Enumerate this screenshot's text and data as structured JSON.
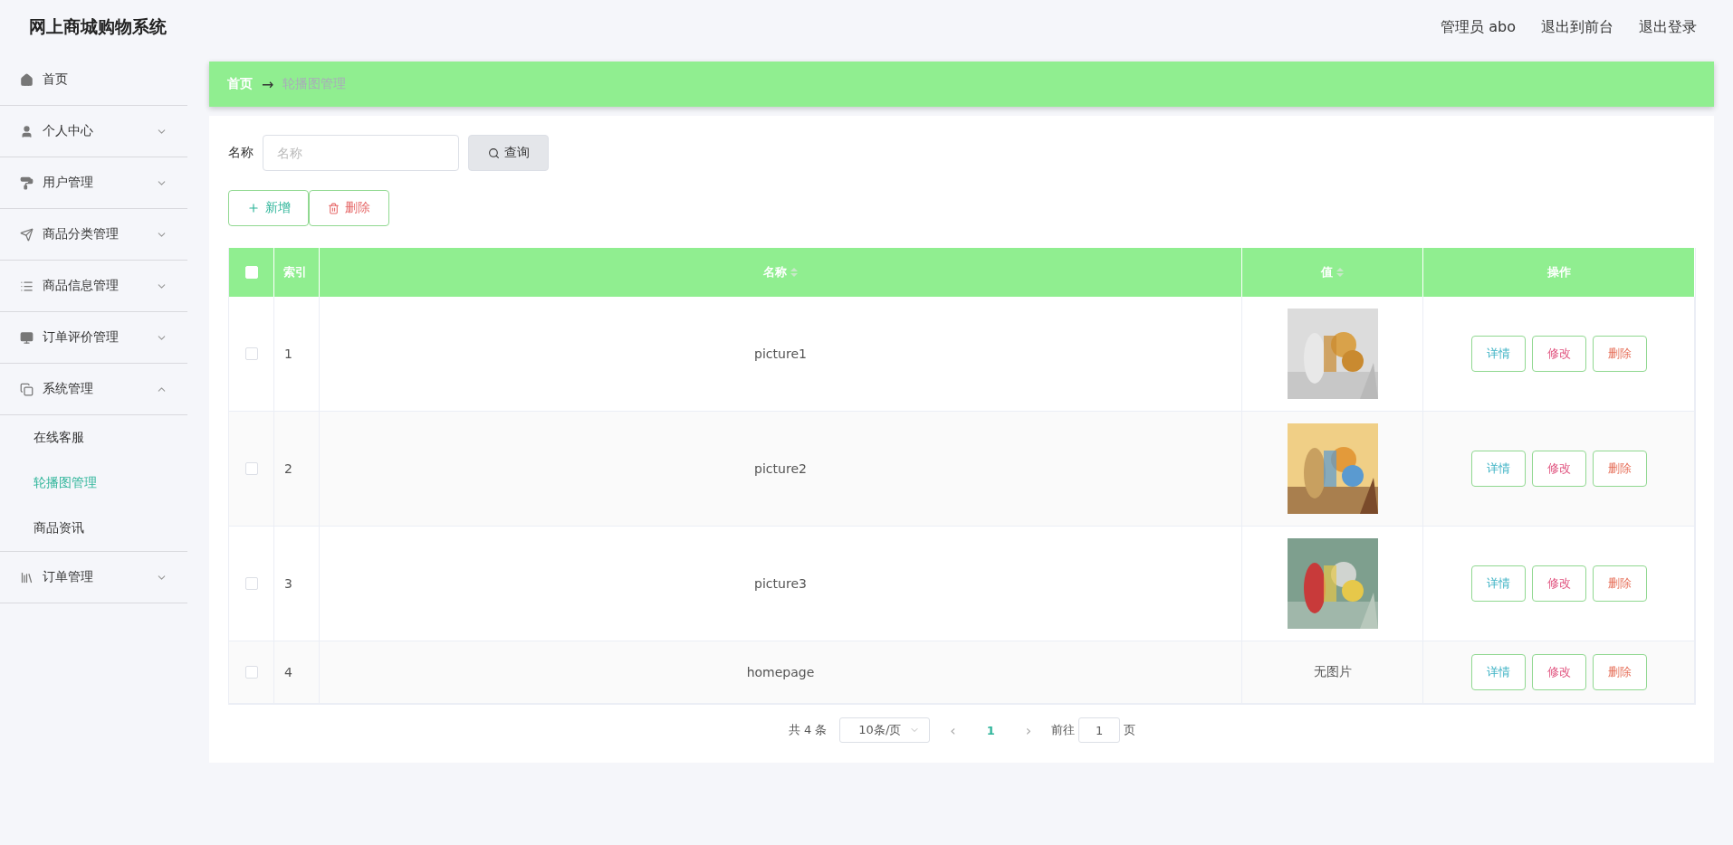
{
  "header": {
    "title": "网上商城购物系统",
    "user": "管理员 abo",
    "links": [
      "退出到前台",
      "退出登录"
    ]
  },
  "sidebar": {
    "items": [
      {
        "label": "首页"
      },
      {
        "label": "个人中心",
        "expandable": true,
        "expanded": false
      },
      {
        "label": "用户管理",
        "expandable": true,
        "expanded": false
      },
      {
        "label": "商品分类管理",
        "expandable": true,
        "expanded": false
      },
      {
        "label": "商品信息管理",
        "expandable": true,
        "expanded": false
      },
      {
        "label": "订单评价管理",
        "expandable": true,
        "expanded": false
      },
      {
        "label": "系统管理",
        "expandable": true,
        "expanded": true,
        "children": [
          {
            "label": "在线客服",
            "selected": false
          },
          {
            "label": "轮播图管理",
            "selected": true
          },
          {
            "label": "商品资讯",
            "selected": false
          }
        ]
      },
      {
        "label": "订单管理",
        "expandable": true,
        "expanded": false
      }
    ]
  },
  "breadcrumb": {
    "home": "首页",
    "separator": "→",
    "current": "轮播图管理"
  },
  "search": {
    "label": "名称",
    "placeholder": "名称",
    "button": "查询"
  },
  "actions": [
    {
      "kind": "add",
      "label": "新增"
    },
    {
      "kind": "delete",
      "label": "删除"
    }
  ],
  "table": {
    "select_all": {
      "checked": false
    },
    "columns": [
      {
        "label": "索引",
        "sortable": false
      },
      {
        "label": "名称",
        "sortable": true
      },
      {
        "label": "值",
        "sortable": true
      },
      {
        "label": "操作",
        "sortable": false
      }
    ],
    "rows": [
      {
        "selected": false,
        "index": "1",
        "name": "picture1",
        "kind": "picture",
        "actions": [
          {
            "kind": "detail",
            "label": "详情"
          },
          {
            "kind": "edit",
            "label": "修改"
          },
          {
            "kind": "delete",
            "label": "删除"
          }
        ]
      },
      {
        "selected": false,
        "index": "2",
        "name": "picture2",
        "kind": "picture",
        "actions": [
          {
            "kind": "detail",
            "label": "详情"
          },
          {
            "kind": "edit",
            "label": "修改"
          },
          {
            "kind": "delete",
            "label": "删除"
          }
        ]
      },
      {
        "selected": false,
        "index": "3",
        "name": "picture3",
        "kind": "picture",
        "actions": [
          {
            "kind": "detail",
            "label": "详情"
          },
          {
            "kind": "edit",
            "label": "修改"
          },
          {
            "kind": "delete",
            "label": "删除"
          }
        ]
      },
      {
        "selected": false,
        "index": "4",
        "name": "homepage",
        "kind": "text",
        "value": "无图片",
        "actions": [
          {
            "kind": "detail",
            "label": "详情"
          },
          {
            "kind": "edit",
            "label": "修改"
          },
          {
            "kind": "delete",
            "label": "删除"
          }
        ]
      }
    ]
  },
  "pagination": {
    "total": "共 4 条",
    "page_size": "10条/页",
    "prev": "‹",
    "pages": [
      {
        "label": "1",
        "selected": true
      }
    ],
    "next": "›",
    "goto": "前往",
    "goto_value": "1",
    "page_unit": "页"
  }
}
